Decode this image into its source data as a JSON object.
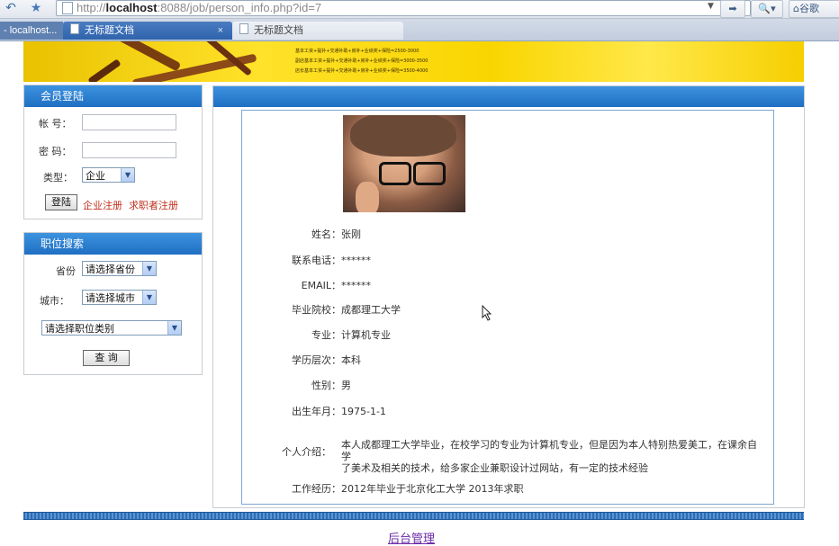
{
  "browser": {
    "url_prefix": "http://",
    "url_host": "localhost",
    "url_rest": ":8088/job/person_info.php?id=7",
    "right_label": "谷歌",
    "tabs": [
      {
        "label": "- localhost..."
      },
      {
        "label": "无标题文档",
        "close": "×"
      },
      {
        "label": "无标题文档"
      }
    ]
  },
  "banner": {
    "lines": [
      "基本工资+提补+交通补助+房补+业绩奖+保险=2500-3000",
      "副店基本工资+提补+交通补助+房补+业绩奖+保险=3000-3500",
      "店长基本工资+提补+交通补助+房补+业绩奖+保险=3500-4000"
    ]
  },
  "login": {
    "title": "会员登陆",
    "account_label": "帐  号：",
    "password_label": "密  码：",
    "type_label": "类型：",
    "type_value": "企业",
    "login_button": "登陆",
    "company_register": "企业注册",
    "jobseeker_register": "求职者注册"
  },
  "search": {
    "title": "职位搜索",
    "province_label": "省份",
    "province_value": "请选择省份",
    "city_label": "城市：",
    "city_value": "请选择城市",
    "category_value": "请选择职位类别",
    "query_button": "查  询"
  },
  "profile": {
    "fields": [
      {
        "label": "姓名：",
        "value": "张刚"
      },
      {
        "label": "联系电话：",
        "value": "******"
      },
      {
        "label": "EMAIL：",
        "value": "******"
      },
      {
        "label": "毕业院校：",
        "value": "成都理工大学"
      },
      {
        "label": "专业：",
        "value": "计算机专业"
      },
      {
        "label": "学历层次：",
        "value": "本科"
      },
      {
        "label": "性别：",
        "value": "男"
      },
      {
        "label": "出生年月：",
        "value": "1975-1-1"
      }
    ],
    "intro_label": "个人介绍：",
    "intro_line1": "本人成都理工大学毕业，在校学习的专业为计算机专业，但是因为本人特别热爱美工，在课余自学",
    "intro_line2": "了美术及相关的技术，给多家企业兼职设计过网站，有一定的技术经验",
    "work_label": "工作经历：",
    "work_value": "2012年毕业于北京化工大学  2013年求职"
  },
  "footer": {
    "admin_link": "后台管理"
  }
}
